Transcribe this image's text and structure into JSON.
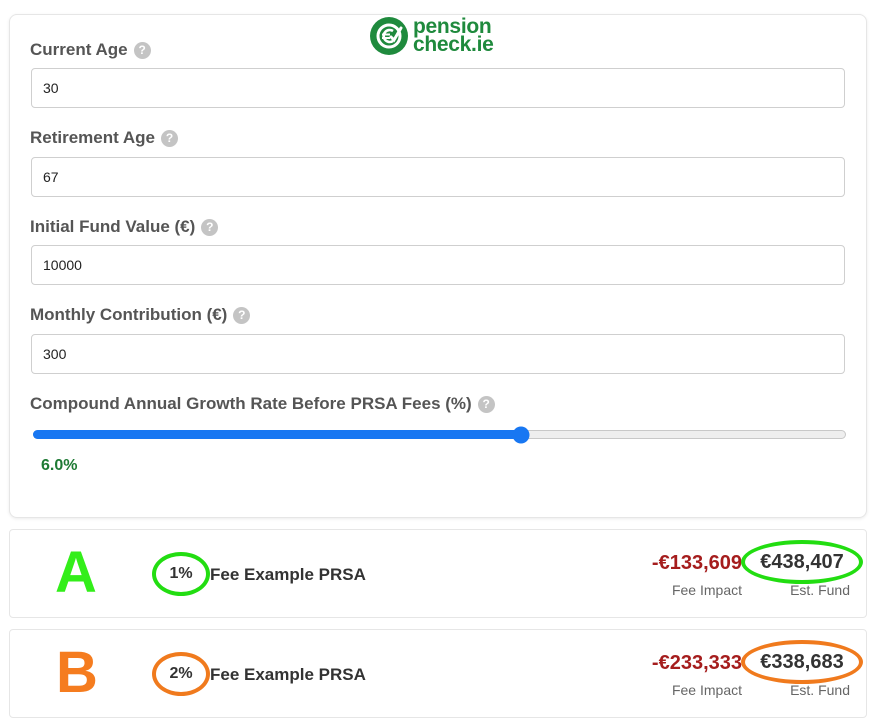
{
  "logo": {
    "line1": "pension",
    "line2": "check.ie",
    "icon": "euro-check-icon",
    "color": "#1f8a3d"
  },
  "fields": {
    "current_age": {
      "label": "Current Age",
      "value": "30"
    },
    "retirement_age": {
      "label": "Retirement Age",
      "value": "67"
    },
    "initial_fund": {
      "label": "Initial Fund Value (€)",
      "value": "10000"
    },
    "monthly_contribution": {
      "label": "Monthly Contribution (€)",
      "value": "300"
    }
  },
  "help_glyph": "?",
  "growth": {
    "label": "Compound Annual Growth Rate Before PRSA Fees (%)",
    "value_text": "6.0%",
    "slider_fraction": 0.6,
    "accent": "#1877f2"
  },
  "results": [
    {
      "letter": "A",
      "letter_color": "#33ee1a",
      "fee": "1%",
      "name": "Fee Example PRSA",
      "fee_impact": "-€133,609",
      "fee_impact_label": "Fee Impact",
      "est_fund": "€438,407",
      "est_fund_label": "Est. Fund",
      "ring_color": "#22dd11"
    },
    {
      "letter": "B",
      "letter_color": "#f57c1f",
      "fee": "2%",
      "name": "Fee Example PRSA",
      "fee_impact": "-€233,333",
      "fee_impact_label": "Fee Impact",
      "est_fund": "€338,683",
      "est_fund_label": "Est. Fund",
      "ring_color": "#f07a1d"
    }
  ]
}
